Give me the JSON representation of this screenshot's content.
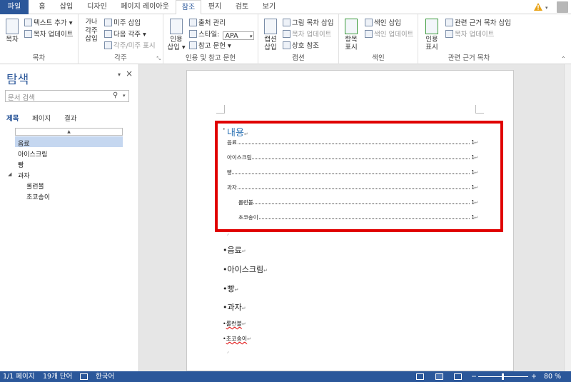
{
  "tabs": {
    "file": "파일",
    "home": "홈",
    "insert": "삽입",
    "design": "디자인",
    "layout": "페이지 레이아웃",
    "references": "참조",
    "mailings": "편지",
    "review": "검토",
    "view": "보기"
  },
  "ribbon": {
    "toc": {
      "toc_btn": "목차",
      "add_text": "텍스트 추가",
      "update_toc": "목차 업데이트",
      "group_label": "목차"
    },
    "footnotes": {
      "insert_footnote_line1": "각주",
      "insert_footnote_line2": "삽입",
      "insert_endnote": "미주 삽입",
      "next_footnote": "다음 각주",
      "show_notes": "각주/미주 표시",
      "group_label": "각주",
      "gana": "가나"
    },
    "citations": {
      "insert_citation_line1": "인용",
      "insert_citation_line2": "삽입",
      "manage_sources": "출처 관리",
      "style_label": "스타일:",
      "style_value": "APA",
      "bibliography": "참고 문헌",
      "group_label": "인용 및 참고 문헌"
    },
    "captions": {
      "insert_caption_line1": "캡션",
      "insert_caption_line2": "삽입",
      "insert_tof": "그림 목차 삽입",
      "update_table": "목차 업데이트",
      "cross_reference": "상호 참조",
      "group_label": "캡션"
    },
    "index": {
      "mark_entry_line1": "항목",
      "mark_entry_line2": "표시",
      "insert_index": "색인 삽입",
      "update_index": "색인 업데이트",
      "group_label": "색인"
    },
    "toa": {
      "mark_citation_line1": "인용",
      "mark_citation_line2": "표시",
      "insert_toa": "관련 근거 목차 삽입",
      "update_table": "목차 업데이트",
      "group_label": "관련 근거 목차"
    }
  },
  "nav": {
    "title": "탐색",
    "search_placeholder": "문서 검색",
    "tabs": [
      "제목",
      "페이지",
      "결과"
    ],
    "headings": [
      {
        "label": "음료",
        "level": 1,
        "selected": true
      },
      {
        "label": "아이스크림",
        "level": 1
      },
      {
        "label": "빵",
        "level": 1
      },
      {
        "label": "과자",
        "level": 1,
        "expanded": true
      },
      {
        "label": "롤런볼",
        "level": 2
      },
      {
        "label": "초코송이",
        "level": 2
      }
    ]
  },
  "document": {
    "toc_title": "내용",
    "toc_entries": [
      {
        "text": "음료",
        "page": "1",
        "indent": 0
      },
      {
        "text": "아이스크림",
        "page": "1",
        "indent": 0
      },
      {
        "text": "빵",
        "page": "1",
        "indent": 0
      },
      {
        "text": "과자",
        "page": "1",
        "indent": 0
      },
      {
        "text": "롤런볼",
        "page": "1",
        "indent": 1
      },
      {
        "text": "초코송이",
        "page": "1",
        "indent": 1
      }
    ],
    "body": [
      "음료",
      "아이스크림",
      "빵",
      "과자",
      "롤런볼",
      "초코송이"
    ]
  },
  "status": {
    "page": "1/1 페이지",
    "words": "19개 단어",
    "language": "한국어",
    "zoom": "80 %"
  },
  "colors": {
    "brand": "#2b579a",
    "heading_blue": "#2e74b5",
    "highlight_box": "#e00000"
  }
}
